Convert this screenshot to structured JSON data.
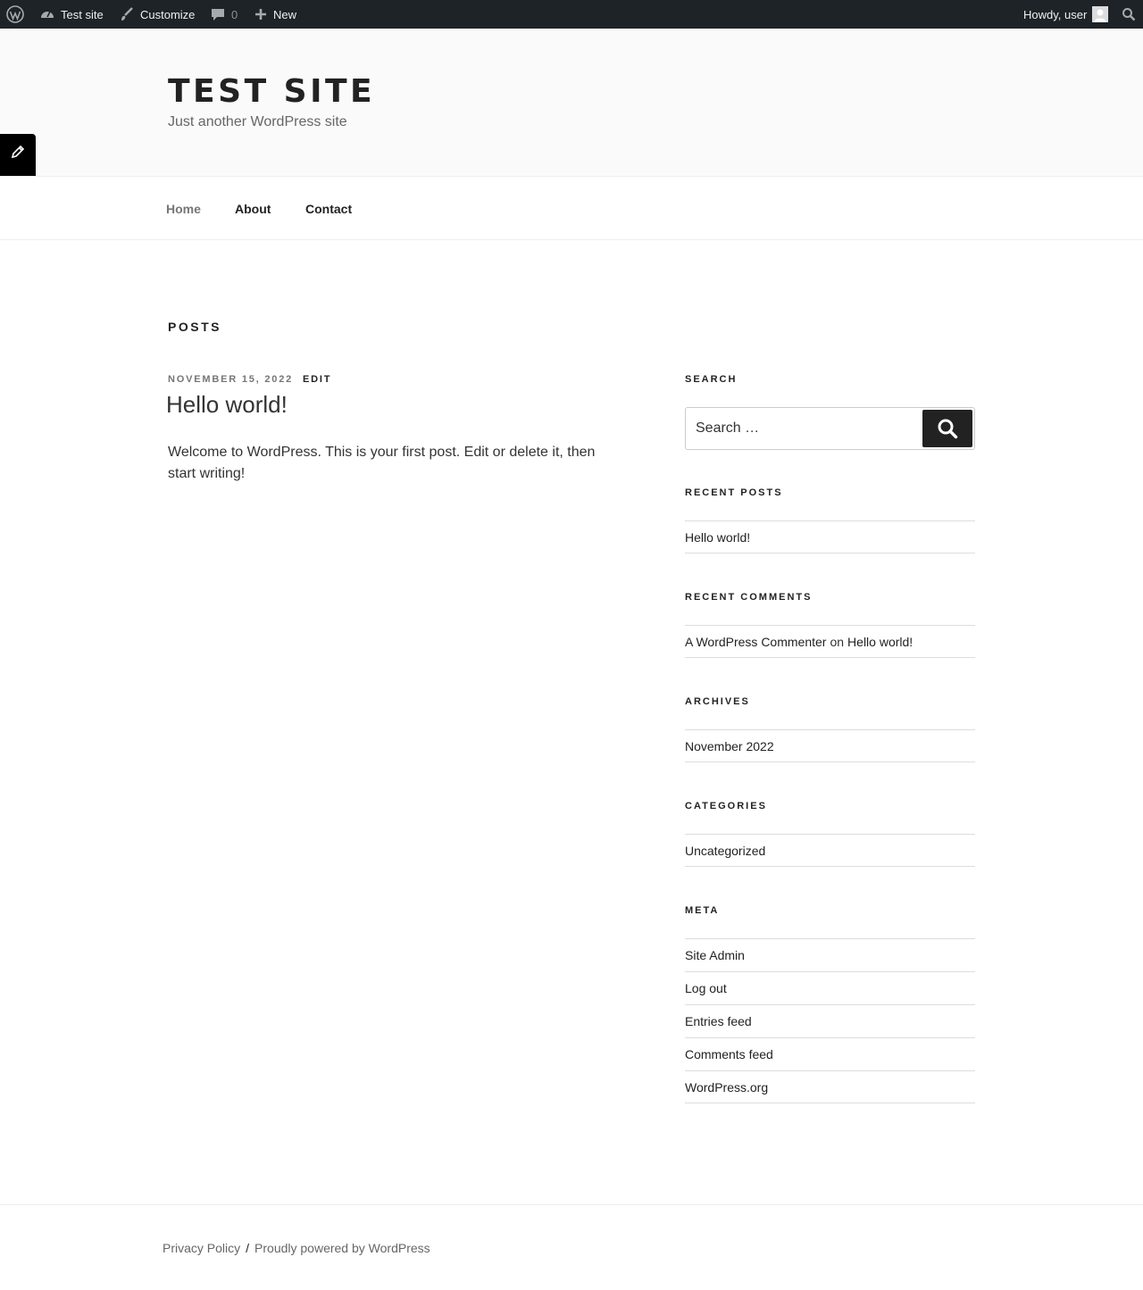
{
  "admin_bar": {
    "site_name": "Test site",
    "customize": "Customize",
    "comments_count": "0",
    "new": "New",
    "greeting": "Howdy, user"
  },
  "header": {
    "title": "TEST SITE",
    "description": "Just another WordPress site"
  },
  "nav": {
    "items": [
      {
        "label": "Home"
      },
      {
        "label": "About"
      },
      {
        "label": "Contact"
      }
    ]
  },
  "main": {
    "page_title": "POSTS",
    "post": {
      "date": "NOVEMBER 15, 2022",
      "edit": "EDIT",
      "title": "Hello world!",
      "body": "Welcome to WordPress. This is your first post. Edit or delete it, then start writing!"
    }
  },
  "sidebar": {
    "search": {
      "title": "SEARCH",
      "placeholder": "Search …"
    },
    "recent_posts": {
      "title": "RECENT POSTS",
      "items": [
        "Hello world!"
      ]
    },
    "recent_comments": {
      "title": "RECENT COMMENTS",
      "author": "A WordPress Commenter",
      "on": "on",
      "post": "Hello world!"
    },
    "archives": {
      "title": "ARCHIVES",
      "items": [
        "November 2022"
      ]
    },
    "categories": {
      "title": "CATEGORIES",
      "items": [
        "Uncategorized"
      ]
    },
    "meta": {
      "title": "META",
      "items": [
        "Site Admin",
        "Log out",
        "Entries feed",
        "Comments feed",
        "WordPress.org"
      ]
    }
  },
  "footer": {
    "privacy": "Privacy Policy",
    "separator": "/",
    "powered": "Proudly powered by WordPress"
  }
}
